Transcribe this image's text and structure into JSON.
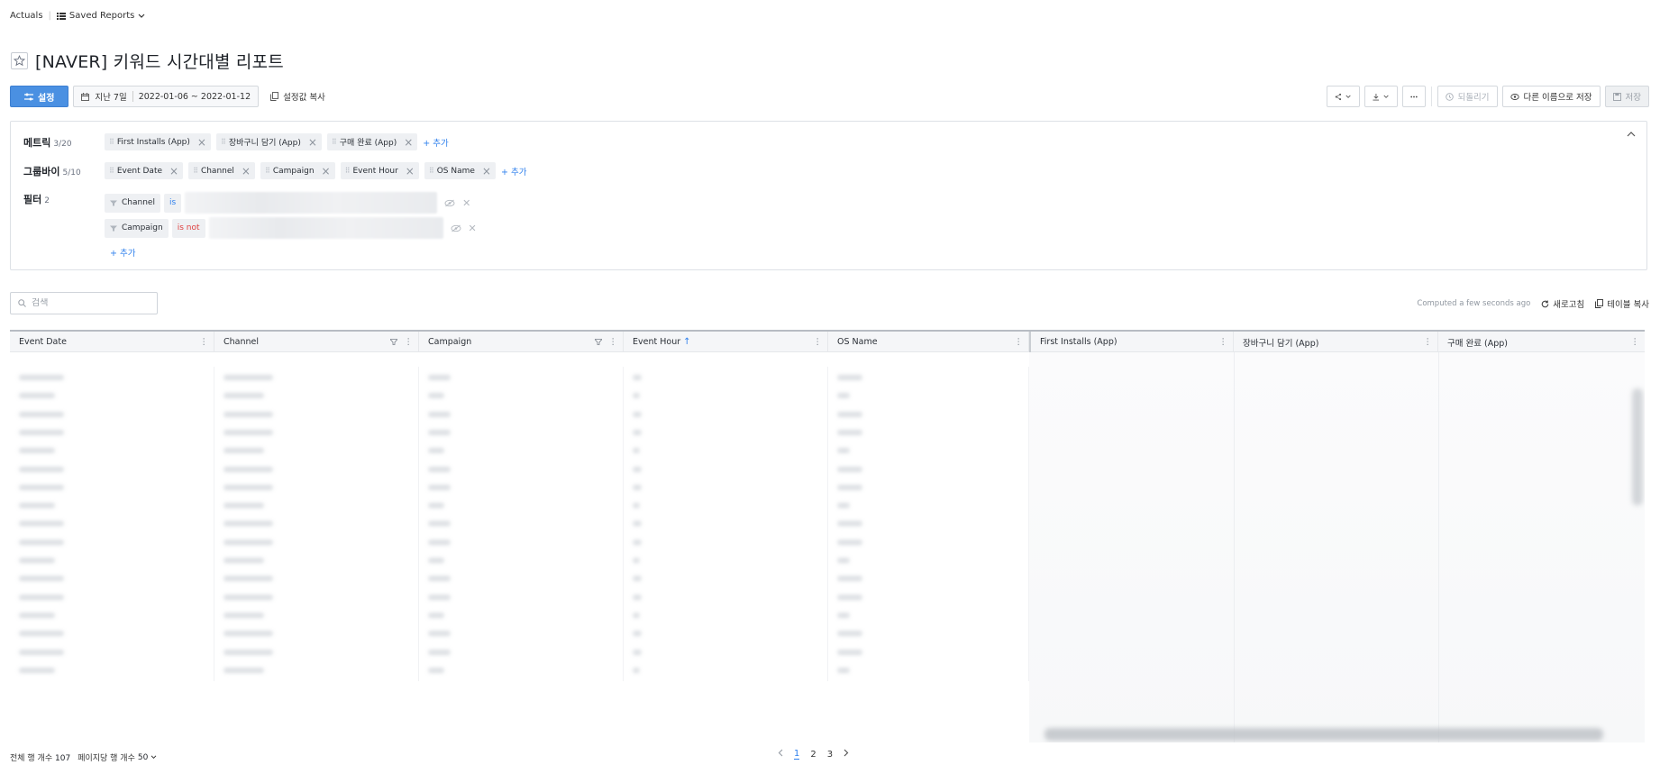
{
  "breadcrumb": {
    "root": "Actuals",
    "current": "Saved Reports"
  },
  "title": "[NAVER] 키워드 시간대별 리포트",
  "toolbar": {
    "settings_label": "설정",
    "date_preset": "지난 7일",
    "date_range": "2022-01-06 ~ 2022-01-12",
    "copy_settings_label": "설정값 복사",
    "revert_label": "되돌리기",
    "save_as_label": "다른 이름으로 저장",
    "save_label": "저장"
  },
  "config": {
    "metrics": {
      "label": "메트릭",
      "count": "3/20",
      "items": [
        "First Installs (App)",
        "장바구니 담기 (App)",
        "구매 완료 (App)"
      ],
      "add_label": "+ 추가"
    },
    "groupby": {
      "label": "그룹바이",
      "count": "5/10",
      "items": [
        "Event Date",
        "Channel",
        "Campaign",
        "Event Hour",
        "OS Name"
      ],
      "add_label": "+ 추가"
    },
    "filters": {
      "label": "필터",
      "count": "2",
      "items": [
        {
          "field": "Channel",
          "operator": "is",
          "operator_color": "#2f80ed"
        },
        {
          "field": "Campaign",
          "operator": "is not",
          "operator_color": "#e03e3e"
        }
      ],
      "add_label": "+ 추가"
    }
  },
  "search": {
    "placeholder": "검색"
  },
  "table_bar": {
    "computed": "Computed a few seconds ago",
    "refresh_label": "새로고침",
    "copy_table_label": "테이블 복사"
  },
  "table": {
    "columns": [
      "Event Date",
      "Channel",
      "Campaign",
      "Event Hour",
      "OS Name",
      "First Installs (App)",
      "장바구니 담기 (App)",
      "구매 완료 (App)"
    ]
  },
  "footer": {
    "total_rows_label": "전체 행 개수",
    "total_rows": "107",
    "per_page_label": "페이지당 행 개수",
    "per_page": "50",
    "pages": [
      "1",
      "2",
      "3"
    ],
    "current_page": "1"
  },
  "colors": {
    "primary": "#4a90e2",
    "link": "#2f80ed",
    "danger": "#e03e3e"
  }
}
